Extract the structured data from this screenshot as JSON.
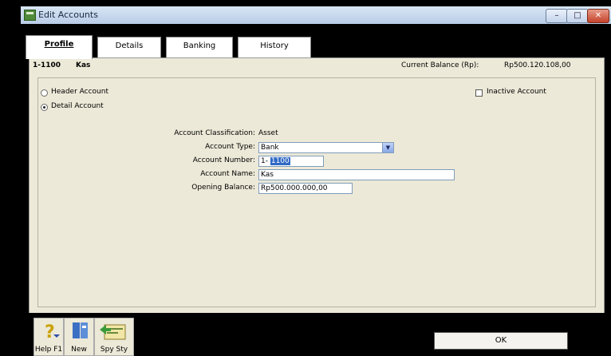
{
  "window": {
    "title": "Edit Accounts",
    "minimize_label": "–",
    "maximize_label": "□",
    "close_label": "✕"
  },
  "tabs": [
    {
      "label": "Profile",
      "active": true
    },
    {
      "label": "Details",
      "active": false
    },
    {
      "label": "Banking",
      "active": false
    },
    {
      "label": "History",
      "active": false
    }
  ],
  "account_header": {
    "id": "1-1100",
    "name": "Kas",
    "current_balance_label": "Current Balance (Rp):",
    "current_balance_value": "Rp500.120.108,00"
  },
  "account_options": {
    "header_account_label": "Header Account",
    "header_account_checked": false,
    "detail_account_label": "Detail Account",
    "detail_account_checked": true,
    "inactive_account_label": "Inactive Account",
    "inactive_account_checked": false
  },
  "form": {
    "classification_label": "Account Classification:",
    "classification_value": "Asset",
    "type_label": "Account Type:",
    "type_value": "Bank",
    "number_label": "Account Number:",
    "number_prefix": "1-",
    "number_value": "1100",
    "name_label": "Account Name:",
    "name_value": "Kas",
    "opening_label": "Opening Balance:",
    "opening_value": "Rp500.000.000,00"
  },
  "toolbar": {
    "help_label": "Help F1",
    "new_label": "New",
    "edit_label": "Spy Sty"
  },
  "ok_label": "OK"
}
